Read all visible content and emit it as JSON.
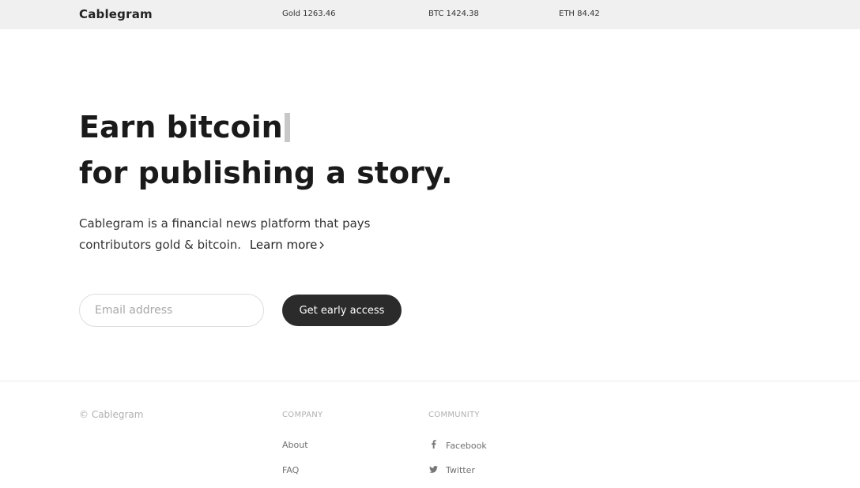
{
  "header": {
    "brand": "Cablegram",
    "tickers": {
      "gold": "Gold 1263.46",
      "btc": "BTC 1424.38",
      "eth": "ETH 84.42"
    }
  },
  "hero": {
    "headline_line1": "Earn bitcoin",
    "headline_line2": "for publishing a story.",
    "description": "Cablegram is a financial news platform that pays contributors gold & bitcoin.",
    "learn_more": "Learn more",
    "learn_more_icon": "chevron-right-icon",
    "email_placeholder": "Email address",
    "email_value": "",
    "cta_label": "Get early access"
  },
  "footer": {
    "copyright": "© Cablegram",
    "company": {
      "heading": "COMPANY",
      "links": [
        "About",
        "FAQ"
      ]
    },
    "community": {
      "heading": "COMMUNITY",
      "links": [
        {
          "label": "Facebook",
          "icon": "facebook-icon"
        },
        {
          "label": "Twitter",
          "icon": "twitter-icon"
        }
      ]
    }
  },
  "colors": {
    "topbar_bg": "#f0f0f0",
    "button_bg": "#2b2b2b",
    "muted_text": "#b0b0b0"
  }
}
